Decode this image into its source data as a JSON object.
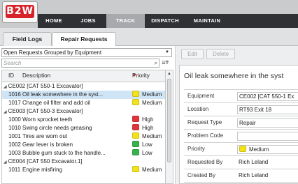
{
  "app": {
    "logo_text": "B2W"
  },
  "nav": {
    "items": [
      {
        "label": "HOME"
      },
      {
        "label": "JOBS"
      },
      {
        "label": "TRACK",
        "active": true
      },
      {
        "label": "DISPATCH"
      },
      {
        "label": "MAINTAIN"
      }
    ]
  },
  "tabs": [
    {
      "label": "Field Logs"
    },
    {
      "label": "Repair Requests",
      "active": true
    }
  ],
  "list": {
    "grouping_select": "Open Requests Grouped by Equipment",
    "search_placeholder": "Search",
    "columns": {
      "id": "ID",
      "description": "Description",
      "priority": "Priority"
    },
    "groups": [
      {
        "label": "CE002 [CAT 550-1 Excavator]",
        "rows": [
          {
            "id": "1016",
            "description": "Oil leak somewhere in the syst...",
            "priority": "Medium",
            "selected": true
          },
          {
            "id": "1017",
            "description": "Change oil filter and add oil",
            "priority": "Medium"
          }
        ]
      },
      {
        "label": "CE003 [CAT 550-3 Excavator]",
        "rows": [
          {
            "id": "1000",
            "description": "Worn sprocket teeth",
            "priority": "High"
          },
          {
            "id": "1010",
            "description": "Swing circle needs greasing",
            "priority": "High"
          },
          {
            "id": "1001",
            "description": "Tires are worn out",
            "priority": "Medium"
          },
          {
            "id": "1002",
            "description": "Gear lever is broken",
            "priority": "Low"
          },
          {
            "id": "1003",
            "description": "Bubble gum stuck to the handle...",
            "priority": "Low"
          }
        ]
      },
      {
        "label": "CE004 [CAT 550 Excavator.1]",
        "rows": [
          {
            "id": "1011",
            "description": "Engine misfiring",
            "priority": "Medium"
          }
        ]
      }
    ]
  },
  "priority_colors": {
    "High": "#e0363b",
    "Medium": "#f2e21a",
    "Low": "#38b24a"
  },
  "detail": {
    "toolbar": {
      "edit_label": "Edit",
      "delete_label": "Delete"
    },
    "title": "Oil leak somewhere in the syst",
    "fields": [
      {
        "label": "Equipment",
        "value": "CE002 [CAT 550-1 Ex"
      },
      {
        "label": "Location",
        "value": "RT93 Exit 18"
      },
      {
        "label": "Request Type",
        "value": "Repair"
      },
      {
        "label": "Problem Code",
        "value": ""
      },
      {
        "label": "Priority",
        "value": "Medium"
      },
      {
        "label": "Requested By",
        "value": "Rich Leland"
      },
      {
        "label": "Created By",
        "value": "Rich Leland"
      }
    ]
  }
}
